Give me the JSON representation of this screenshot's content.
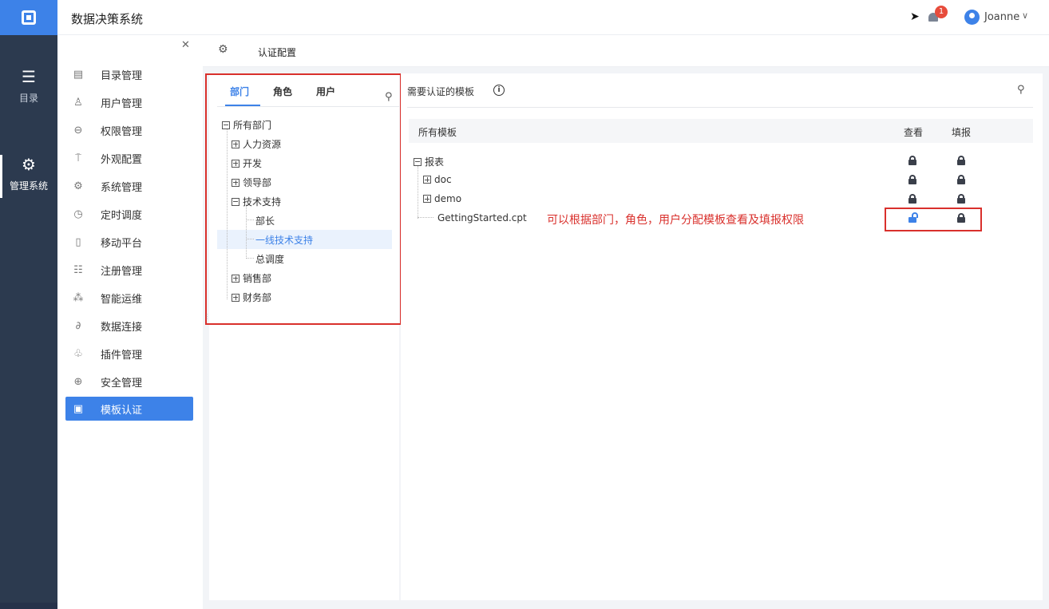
{
  "app": {
    "title": "数据决策系统"
  },
  "header": {
    "notification_count": "1",
    "user_name": "Joanne"
  },
  "rail": {
    "items": [
      {
        "label": "目录",
        "icon": "list-icon"
      },
      {
        "label": "管理系统",
        "icon": "gear-icon"
      }
    ]
  },
  "menu": {
    "items": [
      {
        "label": "目录管理",
        "icon": "catalog-icon"
      },
      {
        "label": "用户管理",
        "icon": "user-icon"
      },
      {
        "label": "权限管理",
        "icon": "lock-icon"
      },
      {
        "label": "外观配置",
        "icon": "brush-icon"
      },
      {
        "label": "系统管理",
        "icon": "gear-icon"
      },
      {
        "label": "定时调度",
        "icon": "timer-icon"
      },
      {
        "label": "移动平台",
        "icon": "mobile-icon"
      },
      {
        "label": "注册管理",
        "icon": "register-icon"
      },
      {
        "label": "智能运维",
        "icon": "ops-icon"
      },
      {
        "label": "数据连接",
        "icon": "link-icon"
      },
      {
        "label": "插件管理",
        "icon": "plugin-icon"
      },
      {
        "label": "安全管理",
        "icon": "shield-icon"
      },
      {
        "label": "模板认证",
        "icon": "template-auth-icon",
        "active": true
      }
    ]
  },
  "breadcrumb": {
    "title": "认证配置"
  },
  "tree": {
    "tabs": [
      "部门",
      "角色",
      "用户"
    ],
    "active_tab": "部门",
    "nodes": {
      "root": "所有部门",
      "hr": "人力资源",
      "dev": "开发",
      "lead": "领导部",
      "tech": "技术支持",
      "tech_head": "部长",
      "tech_frontline": "一线技术支持",
      "tech_dispatch": "总调度",
      "sales": "销售部",
      "finance": "财务部"
    },
    "selected": "一线技术支持"
  },
  "templates": {
    "header": "需要认证的模板",
    "columns": {
      "name": "所有模板",
      "view": "查看",
      "fill": "填报"
    },
    "rows": {
      "root": {
        "label": "报表",
        "view": "locked",
        "fill": "locked"
      },
      "doc": {
        "label": "doc",
        "view": "locked",
        "fill": "locked"
      },
      "demo": {
        "label": "demo",
        "view": "locked",
        "fill": "locked"
      },
      "getting_started": {
        "label": "GettingStarted.cpt",
        "view": "unlocked",
        "fill": "locked"
      }
    },
    "annotation": "可以根据部门，角色，用户分配模板查看及填报权限"
  },
  "colors": {
    "accent": "#3d82e8",
    "rail_bg": "#2c3a4f",
    "highlight_red": "#d9302c"
  }
}
